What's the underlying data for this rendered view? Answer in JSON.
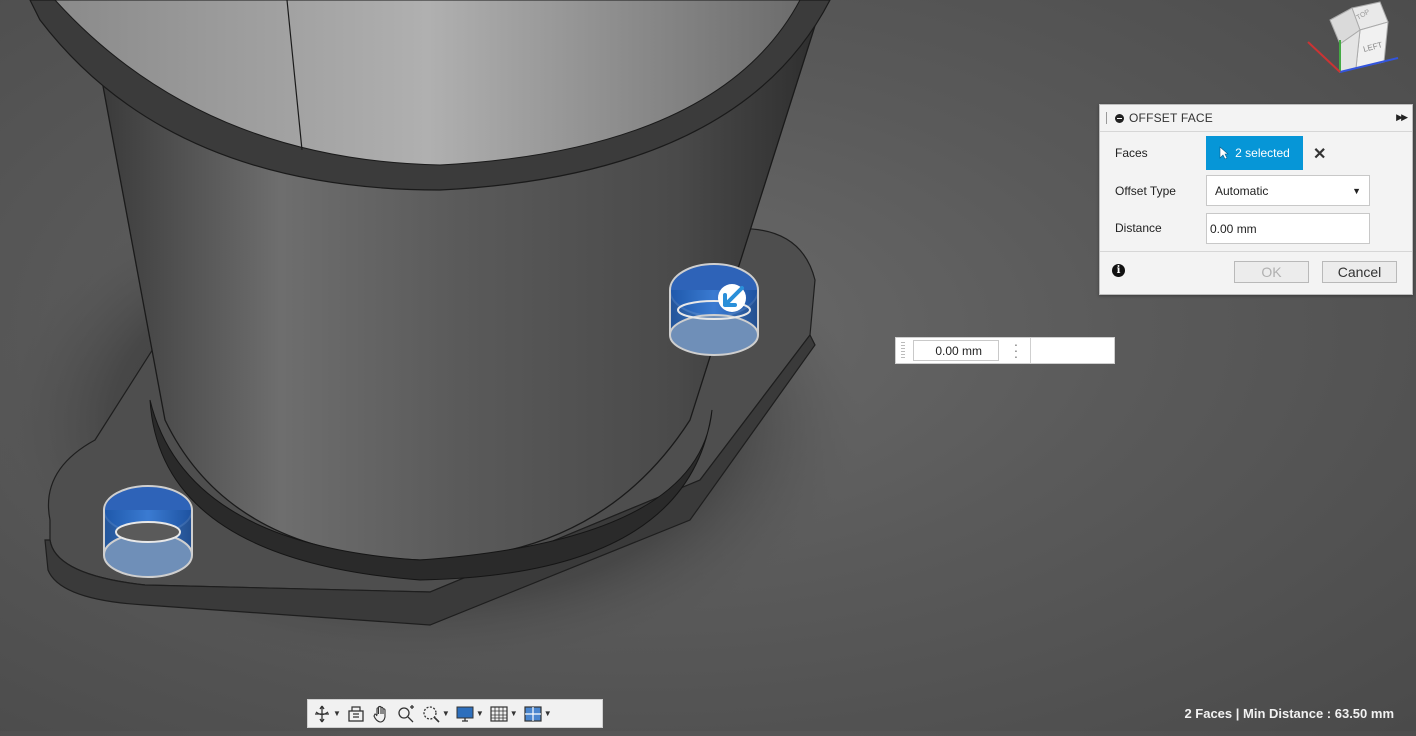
{
  "panel": {
    "title": "OFFSET FACE",
    "faces_label": "Faces",
    "faces_selection": "2 selected",
    "offset_type_label": "Offset Type",
    "offset_type_value": "Automatic",
    "distance_label": "Distance",
    "distance_value": "0.00 mm",
    "ok_label": "OK",
    "cancel_label": "Cancel",
    "accent": "#0696d7"
  },
  "inline_input": {
    "value": "0.00 mm"
  },
  "viewcube": {
    "face_label": "LEFT",
    "top_label": "TOP"
  },
  "status": {
    "text": "2 Faces | Min Distance : 63.50 mm"
  },
  "toolbar": {
    "icons": [
      "orbit-icon",
      "look-at-icon",
      "pan-icon",
      "zoom-icon",
      "fit-icon",
      "display-settings-icon",
      "grid-icon",
      "viewports-icon"
    ]
  }
}
